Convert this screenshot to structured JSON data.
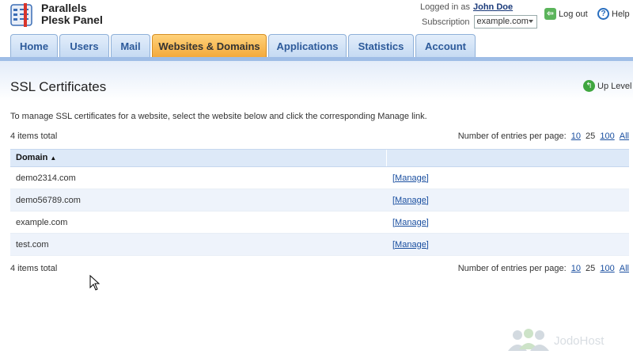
{
  "app": {
    "brand_line1": "Parallels",
    "brand_line2": "Plesk Panel"
  },
  "header": {
    "logged_in_prefix": "Logged in as",
    "user_name": "John Doe",
    "subscription_label": "Subscription",
    "subscription_value": "example.com",
    "logout_label": "Log out",
    "help_label": "Help"
  },
  "tabs": [
    {
      "label": "Home",
      "active": false
    },
    {
      "label": "Users",
      "active": false
    },
    {
      "label": "Mail",
      "active": false
    },
    {
      "label": "Websites & Domains",
      "active": true
    },
    {
      "label": "Applications",
      "active": false
    },
    {
      "label": "Statistics",
      "active": false
    },
    {
      "label": "Account",
      "active": false
    }
  ],
  "page": {
    "title": "SSL Certificates",
    "up_level": "Up Level",
    "description": "To manage SSL certificates for a website, select the website below and click the corresponding Manage link."
  },
  "list": {
    "total_text": "4 items total",
    "per_page_label": "Number of entries per page:",
    "per_page_options": [
      "10",
      "25",
      "100",
      "All"
    ],
    "per_page_current": "25",
    "column_domain": "Domain",
    "sort_indicator": "▲",
    "rows": [
      {
        "domain": "demo2314.com",
        "action": "[Manage]"
      },
      {
        "domain": "demo56789.com",
        "action": "[Manage]"
      },
      {
        "domain": "example.com",
        "action": "[Manage]"
      },
      {
        "domain": "test.com",
        "action": "[Manage]"
      }
    ]
  },
  "watermark": "JodoHost",
  "colors": {
    "active_tab": "#f3a83a",
    "tab": "#c4d9f2",
    "link": "#1a4fa0",
    "header_row": "#dde9f8"
  }
}
